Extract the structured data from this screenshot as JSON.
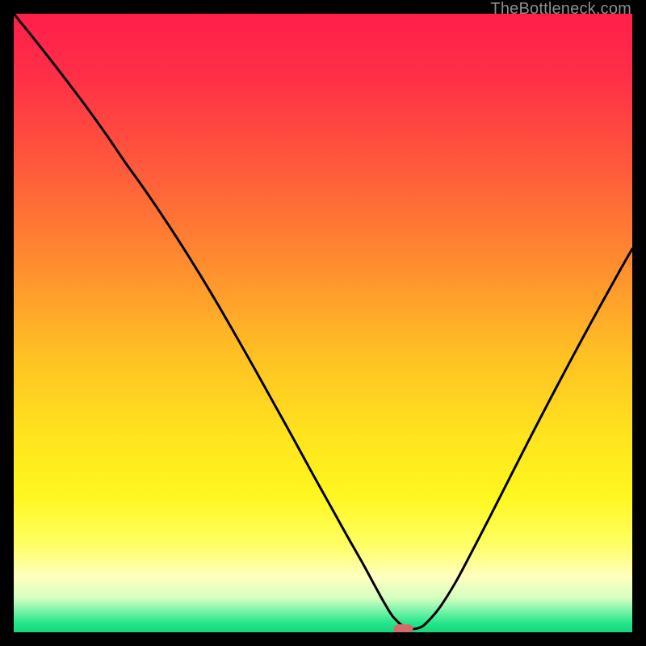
{
  "watermark": "TheBottleneck.com",
  "chart_data": {
    "type": "line",
    "title": "",
    "xlabel": "",
    "ylabel": "",
    "xlim": [
      0,
      100
    ],
    "ylim": [
      0,
      100
    ],
    "grid": false,
    "marker": {
      "x": 63,
      "y": 0.5,
      "shape": "pill",
      "color": "#d46a6a"
    },
    "gradient_stops": [
      {
        "offset": 0.0,
        "color": "#ff1e4b"
      },
      {
        "offset": 0.1,
        "color": "#ff2f47"
      },
      {
        "offset": 0.25,
        "color": "#ff5a3b"
      },
      {
        "offset": 0.4,
        "color": "#ff8b2f"
      },
      {
        "offset": 0.55,
        "color": "#ffc024"
      },
      {
        "offset": 0.68,
        "color": "#ffe31e"
      },
      {
        "offset": 0.78,
        "color": "#fff71f"
      },
      {
        "offset": 0.86,
        "color": "#ffff66"
      },
      {
        "offset": 0.91,
        "color": "#ffffc0"
      },
      {
        "offset": 0.945,
        "color": "#d4ffc0"
      },
      {
        "offset": 0.965,
        "color": "#7bf3a8"
      },
      {
        "offset": 0.985,
        "color": "#25e68a"
      },
      {
        "offset": 1.0,
        "color": "#17d67e"
      }
    ],
    "series": [
      {
        "name": "bottleneck-curve",
        "color": "#000000",
        "x": [
          0.0,
          3.0,
          6.0,
          9.0,
          12.0,
          15.0,
          18.0,
          21.0,
          24.0,
          27.0,
          30.0,
          33.0,
          36.0,
          39.0,
          42.0,
          45.0,
          48.0,
          51.0,
          54.0,
          56.5,
          58.5,
          60.0,
          61.5,
          63.5,
          65.5,
          67.0,
          69.0,
          71.5,
          74.0,
          77.0,
          80.0,
          83.0,
          86.0,
          89.0,
          92.0,
          95.0,
          98.0,
          100.0
        ],
        "y": [
          100.0,
          96.3,
          92.5,
          88.6,
          84.6,
          80.4,
          76.0,
          71.8,
          67.4,
          62.8,
          58.0,
          53.0,
          47.8,
          42.5,
          37.1,
          31.7,
          26.2,
          20.8,
          15.4,
          11.0,
          7.3,
          4.6,
          2.3,
          0.7,
          0.7,
          1.8,
          4.2,
          8.2,
          12.9,
          18.7,
          24.6,
          30.5,
          36.3,
          42.0,
          47.6,
          53.1,
          58.5,
          62.0
        ]
      }
    ]
  }
}
